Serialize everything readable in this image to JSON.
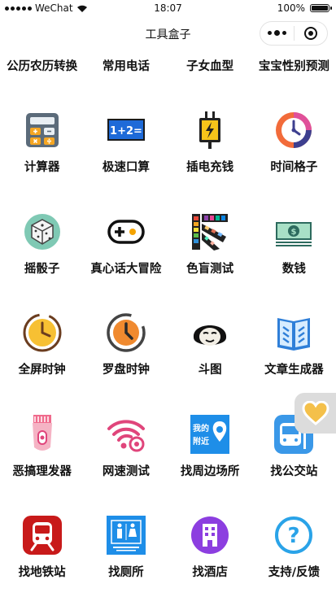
{
  "status": {
    "carrier": "WeChat",
    "time": "18:07",
    "battery": "100%"
  },
  "nav": {
    "title": "工具盒子"
  },
  "top_links": [
    "公历农历转换",
    "常用电话",
    "子女血型",
    "宝宝性别预测"
  ],
  "tools": [
    {
      "label": "计算器",
      "icon": "calculator-icon"
    },
    {
      "label": "极速口算",
      "icon": "math-icon"
    },
    {
      "label": "插电充钱",
      "icon": "plug-icon"
    },
    {
      "label": "时间格子",
      "icon": "clock-icon"
    },
    {
      "label": "摇骰子",
      "icon": "dice-icon"
    },
    {
      "label": "真心话大冒险",
      "icon": "gamepad-icon"
    },
    {
      "label": "色盲测试",
      "icon": "palette-icon"
    },
    {
      "label": "数钱",
      "icon": "money-icon"
    },
    {
      "label": "全屏时钟",
      "icon": "fullscreen-clock-icon"
    },
    {
      "label": "罗盘时钟",
      "icon": "compass-clock-icon"
    },
    {
      "label": "斗图",
      "icon": "meme-face-icon"
    },
    {
      "label": "文章生成器",
      "icon": "book-icon"
    },
    {
      "label": "恶搞理发器",
      "icon": "hair-clipper-icon"
    },
    {
      "label": "网速测试",
      "icon": "wifi-icon"
    },
    {
      "label": "找周边场所",
      "icon": "nearby-icon"
    },
    {
      "label": "找公交站",
      "icon": "bus-icon"
    },
    {
      "label": "找地铁站",
      "icon": "subway-icon"
    },
    {
      "label": "找厕所",
      "icon": "toilet-icon"
    },
    {
      "label": "找酒店",
      "icon": "hotel-icon"
    },
    {
      "label": "支持/反馈",
      "icon": "help-icon"
    }
  ],
  "nearby_icon_text": [
    "我的",
    "附近"
  ],
  "help_icon_text": "?"
}
